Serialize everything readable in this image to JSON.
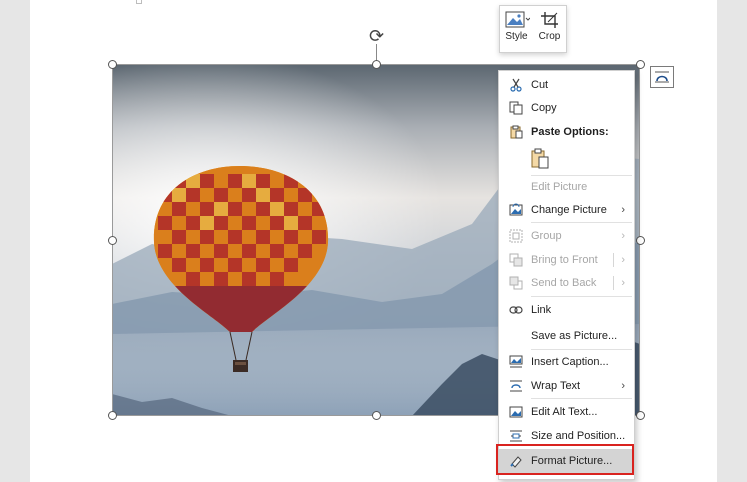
{
  "mini_toolbar": {
    "style_label": "Style",
    "crop_label": "Crop"
  },
  "context_menu": {
    "items": [
      {
        "id": "cut",
        "label": "Cut",
        "icon": "scissors-icon",
        "enabled": true
      },
      {
        "id": "copy",
        "label": "Copy",
        "icon": "copy-icon",
        "enabled": true
      },
      {
        "id": "paste-options",
        "label": "Paste Options:",
        "icon": "paste-icon",
        "enabled": true
      },
      {
        "id": "edit-picture",
        "label": "Edit Picture",
        "enabled": false
      },
      {
        "id": "change-picture",
        "label": "Change Picture",
        "icon": "change-picture-icon",
        "enabled": true,
        "submenu": true
      },
      {
        "id": "group",
        "label": "Group",
        "icon": "group-icon",
        "enabled": false,
        "submenu": true
      },
      {
        "id": "bring-to-front",
        "label": "Bring to Front",
        "icon": "bring-front-icon",
        "enabled": false,
        "submenu": true
      },
      {
        "id": "send-to-back",
        "label": "Send to Back",
        "icon": "send-back-icon",
        "enabled": false,
        "submenu": true
      },
      {
        "id": "link",
        "label": "Link",
        "icon": "link-icon",
        "enabled": true
      },
      {
        "id": "save-as-picture",
        "label": "Save as Picture...",
        "enabled": true
      },
      {
        "id": "insert-caption",
        "label": "Insert Caption...",
        "icon": "caption-icon",
        "enabled": true
      },
      {
        "id": "wrap-text",
        "label": "Wrap Text",
        "icon": "wrap-text-icon",
        "enabled": true,
        "submenu": true
      },
      {
        "id": "edit-alt-text",
        "label": "Edit Alt Text...",
        "icon": "alt-text-icon",
        "enabled": true
      },
      {
        "id": "size-and-position",
        "label": "Size and Position...",
        "icon": "size-position-icon",
        "enabled": true
      },
      {
        "id": "format-picture",
        "label": "Format Picture...",
        "icon": "format-picture-icon",
        "enabled": true,
        "highlighted": true
      }
    ]
  },
  "colors": {
    "highlight_border": "#d9231f",
    "accent_blue": "#2b6cb0",
    "balloon_orange": "#f39c12",
    "balloon_red": "#c0392b"
  }
}
